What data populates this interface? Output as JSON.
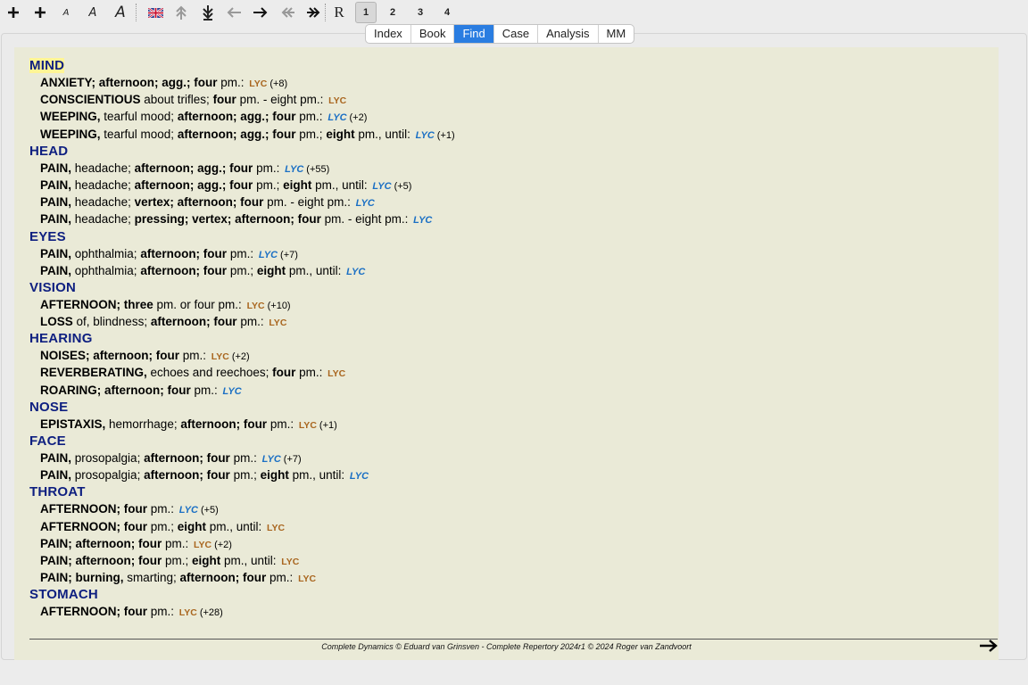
{
  "toolbar": {
    "buttons": [
      {
        "name": "add-icon",
        "kind": "plus"
      },
      {
        "name": "add-bold-icon",
        "kind": "plus"
      },
      {
        "name": "font-small-button",
        "kind": "font",
        "label": "A",
        "size": 10
      },
      {
        "name": "font-medium-button",
        "kind": "font",
        "label": "A",
        "size": 13
      },
      {
        "name": "font-large-button",
        "kind": "font",
        "label": "A",
        "size": 17
      },
      {
        "name": "language-flag-icon",
        "kind": "flag"
      },
      {
        "name": "collapse-all-icon",
        "kind": "tree-up"
      },
      {
        "name": "expand-all-icon",
        "kind": "tree-down"
      },
      {
        "name": "back-arrow-icon",
        "kind": "arrow-left"
      },
      {
        "name": "forward-arrow-icon",
        "kind": "arrow-right"
      },
      {
        "name": "double-back-icon",
        "kind": "dbl-left"
      },
      {
        "name": "double-forward-icon",
        "kind": "dbl-right"
      },
      {
        "name": "remedy-format-button",
        "kind": "text",
        "label": "R"
      },
      {
        "name": "degree-1-button",
        "kind": "num",
        "label": "1",
        "selected": true
      },
      {
        "name": "degree-2-button",
        "kind": "num",
        "label": "2"
      },
      {
        "name": "degree-3-button",
        "kind": "num",
        "label": "3"
      },
      {
        "name": "degree-4-button",
        "kind": "num",
        "label": "4"
      }
    ]
  },
  "tabs": [
    {
      "label": "Index"
    },
    {
      "label": "Book"
    },
    {
      "label": "Find",
      "active": true
    },
    {
      "label": "Case"
    },
    {
      "label": "Analysis"
    },
    {
      "label": "MM"
    }
  ],
  "results": [
    {
      "chapter": "MIND",
      "highlight": true,
      "rubrics": [
        {
          "parts": [
            {
              "t": "ANXIETY; afternoon; agg.; four",
              "b": true
            },
            {
              "t": " pm.:"
            }
          ],
          "remedy": "LYC",
          "degree": 2,
          "count": "(+8)"
        },
        {
          "parts": [
            {
              "t": "CONSCIENTIOUS",
              "b": true
            },
            {
              "t": " about trifles; "
            },
            {
              "t": "four",
              "b": true
            },
            {
              "t": " pm. - eight pm.:"
            }
          ],
          "remedy": "LYC",
          "degree": 2,
          "count": ""
        },
        {
          "parts": [
            {
              "t": "WEEPING,",
              "b": true
            },
            {
              "t": " tearful mood; "
            },
            {
              "t": "afternoon; agg.; four",
              "b": true
            },
            {
              "t": " pm.:"
            }
          ],
          "remedy": "LYC",
          "degree": 3,
          "count": "(+2)"
        },
        {
          "parts": [
            {
              "t": "WEEPING,",
              "b": true
            },
            {
              "t": " tearful mood; "
            },
            {
              "t": "afternoon; agg.; four",
              "b": true
            },
            {
              "t": " pm.; "
            },
            {
              "t": "eight",
              "b": true
            },
            {
              "t": " pm., until:"
            }
          ],
          "remedy": "LYC",
          "degree": 3,
          "count": "(+1)"
        }
      ]
    },
    {
      "chapter": "HEAD",
      "rubrics": [
        {
          "parts": [
            {
              "t": "PAIN,",
              "b": true
            },
            {
              "t": " headache; "
            },
            {
              "t": "afternoon; agg.; four",
              "b": true
            },
            {
              "t": " pm.:"
            }
          ],
          "remedy": "LYC",
          "degree": 3,
          "count": "(+55)"
        },
        {
          "parts": [
            {
              "t": "PAIN,",
              "b": true
            },
            {
              "t": " headache; "
            },
            {
              "t": "afternoon; agg.; four",
              "b": true
            },
            {
              "t": " pm.; "
            },
            {
              "t": "eight",
              "b": true
            },
            {
              "t": " pm., until:"
            }
          ],
          "remedy": "LYC",
          "degree": 3,
          "count": "(+5)"
        },
        {
          "parts": [
            {
              "t": "PAIN,",
              "b": true
            },
            {
              "t": " headache; "
            },
            {
              "t": "vertex; afternoon; four",
              "b": true
            },
            {
              "t": " pm. - eight pm.:"
            }
          ],
          "remedy": "LYC",
          "degree": 3,
          "count": ""
        },
        {
          "parts": [
            {
              "t": "PAIN,",
              "b": true
            },
            {
              "t": " headache; "
            },
            {
              "t": "pressing; vertex; afternoon; four",
              "b": true
            },
            {
              "t": " pm. - eight pm.:"
            }
          ],
          "remedy": "LYC",
          "degree": 3,
          "count": ""
        }
      ]
    },
    {
      "chapter": "EYES",
      "rubrics": [
        {
          "parts": [
            {
              "t": "PAIN,",
              "b": true
            },
            {
              "t": " ophthalmia; "
            },
            {
              "t": "afternoon; four",
              "b": true
            },
            {
              "t": " pm.:"
            }
          ],
          "remedy": "LYC",
          "degree": 3,
          "count": "(+7)"
        },
        {
          "parts": [
            {
              "t": "PAIN,",
              "b": true
            },
            {
              "t": " ophthalmia; "
            },
            {
              "t": "afternoon; four",
              "b": true
            },
            {
              "t": " pm.; "
            },
            {
              "t": "eight",
              "b": true
            },
            {
              "t": " pm., until:"
            }
          ],
          "remedy": "LYC",
          "degree": 3,
          "count": ""
        }
      ]
    },
    {
      "chapter": "VISION",
      "rubrics": [
        {
          "parts": [
            {
              "t": "AFTERNOON; three",
              "b": true
            },
            {
              "t": " pm. or four pm.:"
            }
          ],
          "remedy": "LYC",
          "degree": 2,
          "count": "(+10)"
        },
        {
          "parts": [
            {
              "t": "LOSS",
              "b": true
            },
            {
              "t": " of, blindness; "
            },
            {
              "t": "afternoon; four",
              "b": true
            },
            {
              "t": " pm.:"
            }
          ],
          "remedy": "LYC",
          "degree": 2,
          "count": ""
        }
      ]
    },
    {
      "chapter": "HEARING",
      "rubrics": [
        {
          "parts": [
            {
              "t": "NOISES; afternoon; four",
              "b": true
            },
            {
              "t": " pm.:"
            }
          ],
          "remedy": "LYC",
          "degree": 2,
          "count": "(+2)"
        },
        {
          "parts": [
            {
              "t": "REVERBERATING,",
              "b": true
            },
            {
              "t": " echoes and reechoes; "
            },
            {
              "t": "four",
              "b": true
            },
            {
              "t": " pm.:"
            }
          ],
          "remedy": "LYC",
          "degree": 2,
          "count": ""
        },
        {
          "parts": [
            {
              "t": "ROARING; afternoon; four",
              "b": true
            },
            {
              "t": " pm.:"
            }
          ],
          "remedy": "LYC",
          "degree": 3,
          "count": ""
        }
      ]
    },
    {
      "chapter": "NOSE",
      "rubrics": [
        {
          "parts": [
            {
              "t": "EPISTAXIS,",
              "b": true
            },
            {
              "t": " hemorrhage; "
            },
            {
              "t": "afternoon; four",
              "b": true
            },
            {
              "t": " pm.:"
            }
          ],
          "remedy": "LYC",
          "degree": 2,
          "count": "(+1)"
        }
      ]
    },
    {
      "chapter": "FACE",
      "rubrics": [
        {
          "parts": [
            {
              "t": "PAIN,",
              "b": true
            },
            {
              "t": " prosopalgia; "
            },
            {
              "t": "afternoon; four",
              "b": true
            },
            {
              "t": " pm.:"
            }
          ],
          "remedy": "LYC",
          "degree": 3,
          "count": "(+7)"
        },
        {
          "parts": [
            {
              "t": "PAIN,",
              "b": true
            },
            {
              "t": " prosopalgia; "
            },
            {
              "t": "afternoon; four",
              "b": true
            },
            {
              "t": " pm.; "
            },
            {
              "t": "eight",
              "b": true
            },
            {
              "t": " pm., until:"
            }
          ],
          "remedy": "LYC",
          "degree": 3,
          "count": ""
        }
      ]
    },
    {
      "chapter": "THROAT",
      "rubrics": [
        {
          "parts": [
            {
              "t": "AFTERNOON; four",
              "b": true
            },
            {
              "t": " pm.:"
            }
          ],
          "remedy": "LYC",
          "degree": 3,
          "count": "(+5)"
        },
        {
          "parts": [
            {
              "t": "AFTERNOON; four",
              "b": true
            },
            {
              "t": " pm.; "
            },
            {
              "t": "eight",
              "b": true
            },
            {
              "t": " pm., until:"
            }
          ],
          "remedy": "LYC",
          "degree": 2,
          "count": ""
        },
        {
          "parts": [
            {
              "t": "PAIN; afternoon; four",
              "b": true
            },
            {
              "t": " pm.:"
            }
          ],
          "remedy": "LYC",
          "degree": 2,
          "count": "(+2)"
        },
        {
          "parts": [
            {
              "t": "PAIN; afternoon; four",
              "b": true
            },
            {
              "t": " pm.; "
            },
            {
              "t": "eight",
              "b": true
            },
            {
              "t": " pm., until:"
            }
          ],
          "remedy": "LYC",
          "degree": 2,
          "count": ""
        },
        {
          "parts": [
            {
              "t": "PAIN; burning,",
              "b": true
            },
            {
              "t": " smarting; "
            },
            {
              "t": "afternoon; four",
              "b": true
            },
            {
              "t": " pm.:"
            }
          ],
          "remedy": "LYC",
          "degree": 2,
          "count": ""
        }
      ]
    },
    {
      "chapter": "STOMACH",
      "rubrics": [
        {
          "parts": [
            {
              "t": "AFTERNOON; four",
              "b": true
            },
            {
              "t": " pm.:"
            }
          ],
          "remedy": "LYC",
          "degree": 2,
          "count": "(+28)"
        }
      ]
    }
  ],
  "footer": "Complete Dynamics © Eduard van Grinsven  -  Complete Repertory 2024r1 © 2024 Roger van Zandvoort",
  "colors": {
    "degree2": "#a9661f",
    "degree3": "#1a6fc4",
    "chapter": "#0e1f80",
    "tab_active": "#2a7de1",
    "content_bg": "#eaead7",
    "highlight": "#fff596"
  }
}
